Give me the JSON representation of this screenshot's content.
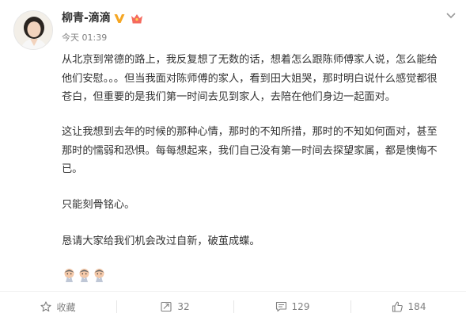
{
  "post": {
    "author": "柳青-滴滴",
    "time": "今天 01:39",
    "paragraphs": [
      "从北京到常德的路上，我反复想了无数的话，想着怎么跟陈师傅家人说，怎么能给他们安慰。。。但当我面对陈师傅的家人，看到田大姐哭，那时明白说什么感觉都很苍白，但重要的是我们第一时间去见到家人，去陪在他们身边一起面对。",
      "这让我想到去年的时候的那种心情，那时的不知所措，那时的不知如何面对，甚至那时的懦弱和恐惧。每每想起来，我们自己没有第一时间去探望家属，都是懊悔不已。",
      "只能刻骨铭心。",
      "恳请大家给我们机会改过自新，破茧成蝶。"
    ],
    "emoji_names": [
      "pray-emoji",
      "pray-emoji",
      "pray-emoji"
    ]
  },
  "actions": {
    "favorite_label": "收藏",
    "repost_count": "32",
    "comment_count": "129",
    "like_count": "184"
  },
  "icons": {
    "verified": "verified-v-icon",
    "member": "vip-crown-icon",
    "more": "chevron-down-icon",
    "favorite": "star-icon",
    "repost": "repost-icon",
    "comment": "comment-icon",
    "like": "thumbs-up-icon"
  },
  "colors": {
    "verified": "#f5a623",
    "member": "#f56a5e",
    "text": "#333333",
    "muted": "#808080"
  }
}
